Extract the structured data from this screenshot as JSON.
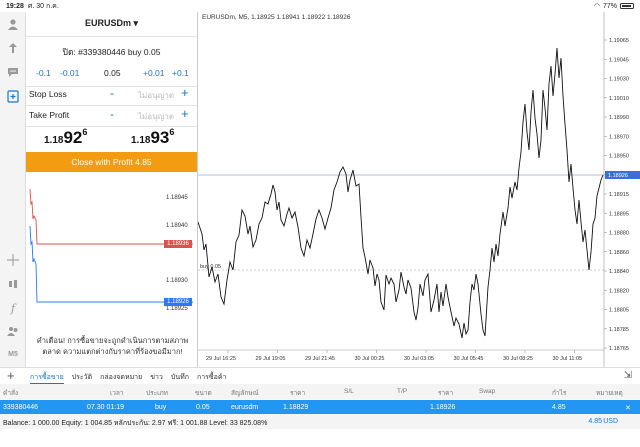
{
  "status_bar": {
    "time": "19:28",
    "date": "ศ. 30 ก.ค.",
    "battery": "77%"
  },
  "sidebar_icons": [
    "user-icon",
    "connect-icon",
    "chat-icon",
    "new-order-icon",
    "crosshair-icon",
    "indicators-icon",
    "objects-icon",
    "accounts-icon",
    "timeframe-icon"
  ],
  "timeframe_label": "M5",
  "order": {
    "symbol": "EURUSDm",
    "symbol_caret": "▾",
    "position_text": "ปิด: #339380446 buy 0.05",
    "volume": {
      "dec1": "-0.1",
      "dec2": "-0.01",
      "value": "0.05",
      "inc1": "+0.01",
      "inc2": "+0.1"
    },
    "stop_loss": {
      "label": "Stop Loss",
      "minus": "-",
      "placeholder": "ไม่อนุญาต",
      "plus": "+"
    },
    "take_profit": {
      "label": "Take Profit",
      "minus": "-",
      "placeholder": "ไม่อนุญาต",
      "plus": "+"
    },
    "bid": {
      "prefix": "1.18",
      "big": "92",
      "sup": "6"
    },
    "ask": {
      "prefix": "1.18",
      "big": "93",
      "sup": "6"
    },
    "close_button": "Close with Profit 4.85",
    "warning": "คำเตือน! การซื้อขายจะถูกดำเนินการตามสภาพตลาด ความแตกต่างกับราคาที่ร้องขอมีมาก!"
  },
  "mini_chart": {
    "labels": [
      "1.18945",
      "1.18940",
      "1.18930",
      "1.18925"
    ],
    "ask_tag": "1.18936",
    "bid_tag": "1.18926",
    "ask_color": "#d9534f",
    "bid_color": "#2979ff"
  },
  "chart": {
    "title": "EURUSDm, M5, 1.18925 1.18941 1.18922 1.18926",
    "price_labels": [
      "1.19065",
      "1.19045",
      "1.19030",
      "1.19010",
      "1.18990",
      "1.18970",
      "1.18950",
      "1.18930",
      "1.18915",
      "1.18895",
      "1.18880",
      "1.18860",
      "1.18840",
      "1.18820",
      "1.18805",
      "1.18785",
      "1.18765"
    ],
    "price_tag": "1.18926",
    "entry_label": "buy 0.05",
    "time_labels": [
      "29 Jul 16:25",
      "29 Jul 19:05",
      "29 Jul 21:45",
      "30 Jul 00:25",
      "30 Jul 03:05",
      "30 Jul 05:45",
      "30 Jul 08:25",
      "30 Jul 11:05"
    ]
  },
  "bottom": {
    "tabs": [
      "การซื้อขาย",
      "ประวัติ",
      "กล่องจดหมาย",
      "ข่าว",
      "บันทึก",
      "การซื้อค้า"
    ],
    "columns": [
      "คำสั่ง",
      "เวลา",
      "ประเภท",
      "ขนาด",
      "สัญลักษณ์",
      "ราคา",
      "S/L",
      "T/P",
      "ราคา",
      "Swap",
      "กำไร",
      "หมายเหตุ"
    ],
    "row": {
      "order": "339380446",
      "time": "07.30 01:19",
      "type": "buy",
      "size": "0.05",
      "symbol": "eurusdm",
      "open_price": "1.18829",
      "sl": "",
      "tp": "",
      "price": "1.18926",
      "swap": "",
      "profit": "4.85",
      "comment": ""
    },
    "balance_text": "Balance: 1 000.00 Equity: 1 004.85 หลักประกัน: 2.97 ฟรี: 1 001.88 Level: 33 825.08%",
    "total_profit": "4.85",
    "currency": "USD"
  }
}
